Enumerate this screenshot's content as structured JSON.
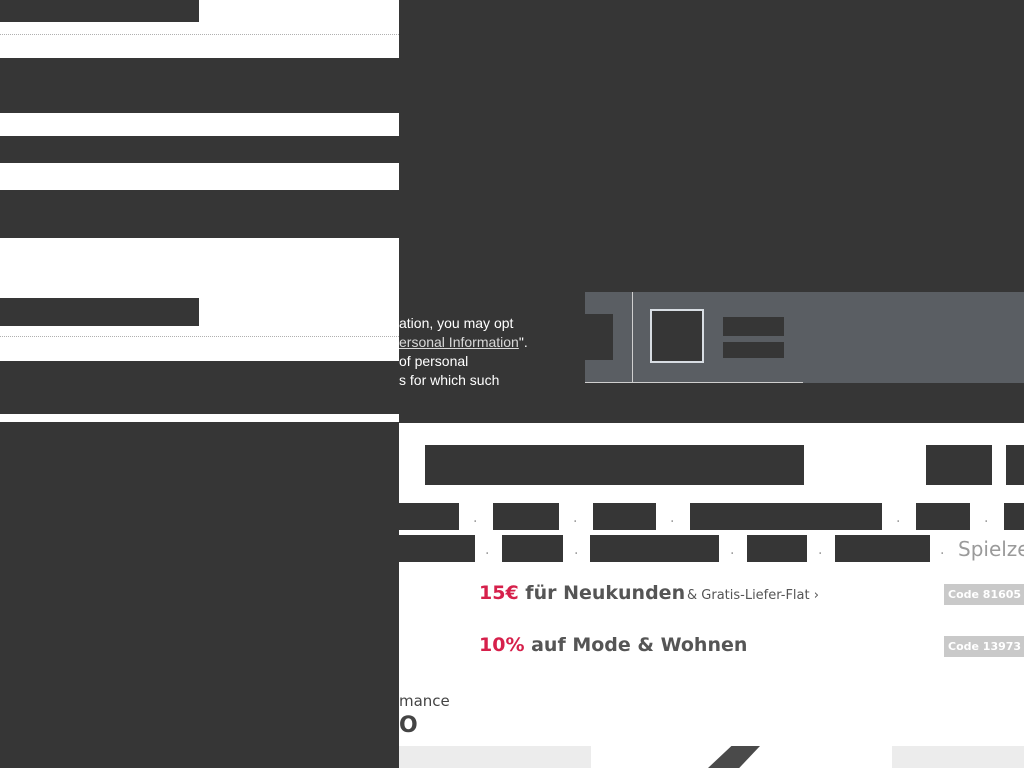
{
  "privacy": {
    "line1": "ation, you may opt",
    "line2_prefix": "",
    "link_text": "ersonal Information",
    "line2_suffix": "\".",
    "line3": "of personal",
    "line4": "s for which such"
  },
  "nav": {
    "tail_label": "Spielze"
  },
  "promos": [
    {
      "amount": "15€",
      "text": "für Neukunden",
      "sub": "& Gratis-Liefer-Flat ›",
      "code": "Code 81605"
    },
    {
      "amount": "10%",
      "text": "auf Mode & Wohnen",
      "sub": "",
      "code": "Code 13973"
    }
  ],
  "section": {
    "kicker": "mance",
    "heading": "O"
  },
  "colors": {
    "overlay": "#363636",
    "accent": "#d6204b",
    "badge": "#c9c9c9",
    "pref_panel": "#5a5e63"
  }
}
